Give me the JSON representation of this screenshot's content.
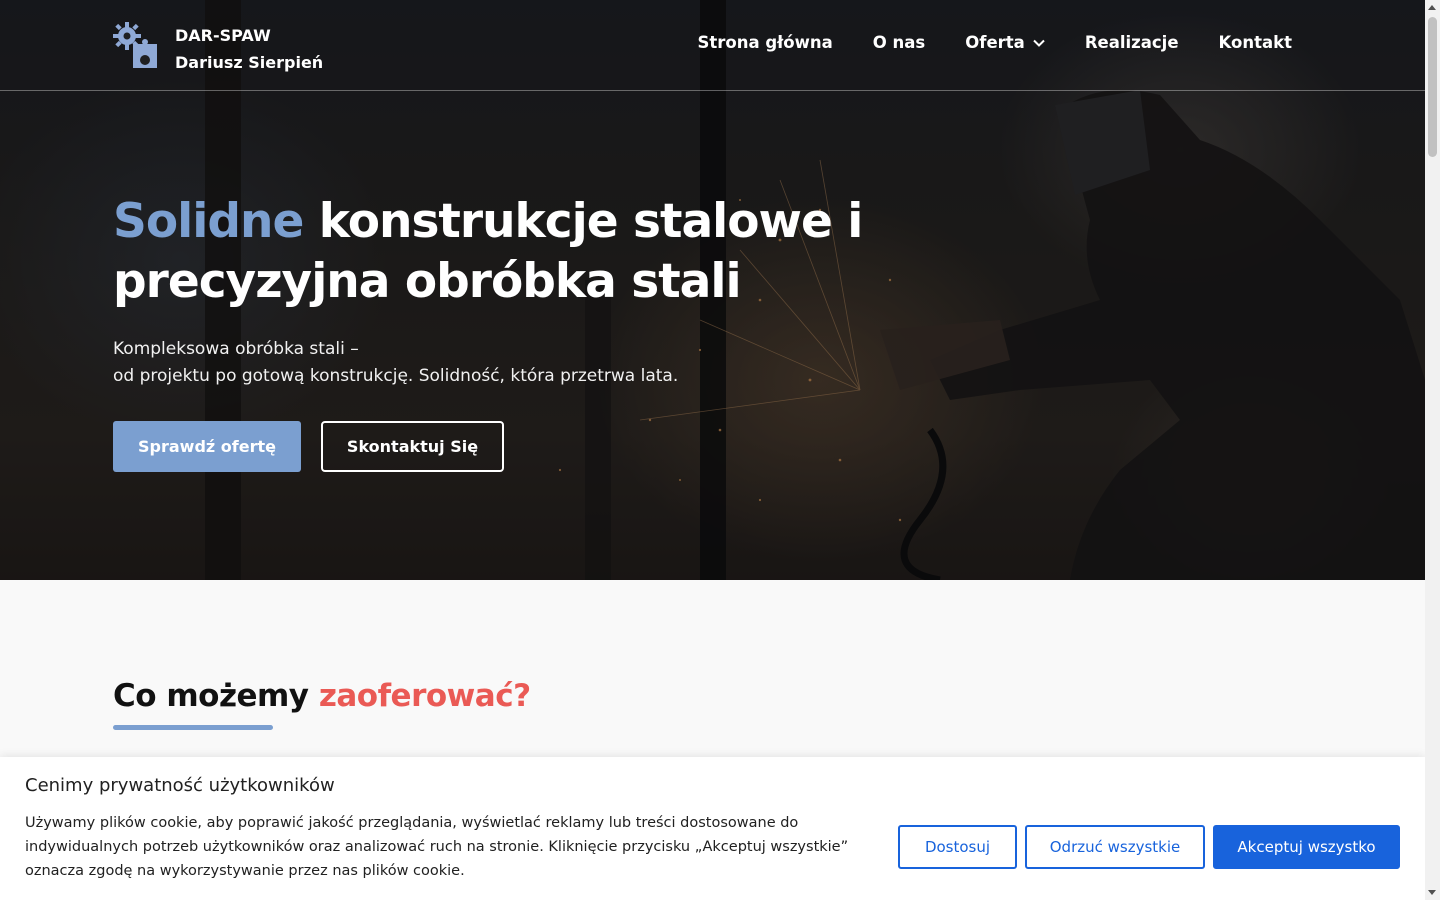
{
  "brand": {
    "name_line1": "DAR-SPAW",
    "name_line2": "Dariusz Sierpień",
    "logo_icon": "gears-icon",
    "accent_color": "#7b9fd0"
  },
  "nav": {
    "items": [
      {
        "label": "Strona główna"
      },
      {
        "label": "O nas"
      },
      {
        "label": "Oferta",
        "icon": "chevron-down-icon"
      },
      {
        "label": "Realizacje"
      },
      {
        "label": "Kontakt"
      }
    ]
  },
  "hero": {
    "title_accent": "Solidne",
    "title_rest": " konstrukcje stalowe i precyzyjna obróbka stali",
    "subtitle_line1": "Kompleksowa obróbka stali –",
    "subtitle_line2": "od projektu po gotową konstrukcję. Solidność, która przetrwa lata.",
    "primary_button": "Sprawdź ofertę",
    "secondary_button": "Skontaktuj Się"
  },
  "offer_section": {
    "title_main": "Co możemy ",
    "title_accent": "zaoferować?",
    "accent_color": "#ea5a55"
  },
  "cookie_banner": {
    "title": "Cenimy prywatność użytkowników",
    "text": "Używamy plików cookie, aby poprawić jakość przeglądania, wyświetlać reklamy lub treści dostosowane do indywidualnych potrzeb użytkowników oraz analizować ruch na stronie. Kliknięcie przycisku „Akceptuj wszystkie” oznacza zgodę na wykorzystywanie przez nas plików cookie.",
    "customize_button": "Dostosuj",
    "reject_button": "Odrzuć wszystkie",
    "accept_button": "Akceptuj wszystko",
    "button_color": "#1863dc"
  }
}
